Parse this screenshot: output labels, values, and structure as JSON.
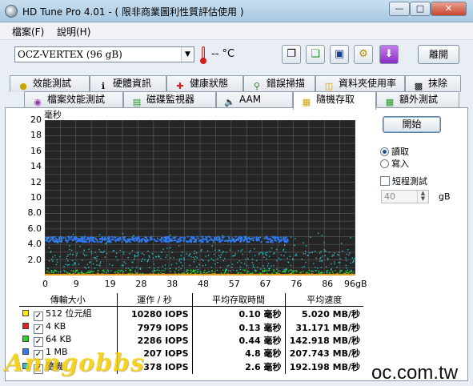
{
  "window": {
    "title": "HD Tune Pro 4.01 - ( 限非商業圖利性質評估使用 )"
  },
  "menu": [
    {
      "label": "檔案(F)"
    },
    {
      "label": "說明(H)"
    }
  ],
  "toolbar": {
    "drive": "OCZ-VERTEX (96 gB)",
    "temperature": "-- °C",
    "exit_label": "離開",
    "icons": [
      "copy-icon",
      "copy-all-icon",
      "save-icon",
      "options-icon",
      "download-icon"
    ]
  },
  "tabs_row1": [
    {
      "label": "效能測試",
      "icon": "benchmark-icon"
    },
    {
      "label": "硬體資訊",
      "icon": "info-icon"
    },
    {
      "label": "健康狀態",
      "icon": "health-icon"
    },
    {
      "label": "錯誤掃描",
      "icon": "error-scan-icon"
    },
    {
      "label": "資料夾使用率",
      "icon": "folder-usage-icon"
    },
    {
      "label": "抹除",
      "icon": "erase-icon"
    }
  ],
  "tabs_row2": [
    {
      "label": "檔案效能測試",
      "icon": "file-benchmark-icon"
    },
    {
      "label": "磁碟監視器",
      "icon": "disk-monitor-icon"
    },
    {
      "label": "AAM",
      "icon": "aam-icon"
    },
    {
      "label": "隨機存取",
      "icon": "random-access-icon",
      "active": true
    },
    {
      "label": "額外測試",
      "icon": "extra-tests-icon"
    }
  ],
  "side": {
    "start_label": "開始",
    "read_label": "讀取",
    "write_label": "寫入",
    "selected_mode": "read",
    "short_test_label": "短程測試",
    "short_test_checked": false,
    "short_test_value": "40",
    "short_test_unit": "gB"
  },
  "chart_data": {
    "type": "scatter",
    "ylabel": "毫秒",
    "y_ticks": [
      "20",
      "18",
      "16",
      "14",
      "12",
      "10",
      "8.0",
      "6.0",
      "4.0",
      "2.0"
    ],
    "x_ticks": [
      "0",
      "9",
      "19",
      "28",
      "38",
      "48",
      "57",
      "67",
      "76",
      "86",
      "96gB"
    ],
    "xlim": [
      0,
      96
    ],
    "ylim": [
      0,
      20
    ],
    "grid": true,
    "series": [
      {
        "name": "512 位元組",
        "color": "#ffea00",
        "band": [
          0.0,
          0.3
        ]
      },
      {
        "name": "4 KB",
        "color": "#e32222",
        "band": [
          0.0,
          0.3
        ]
      },
      {
        "name": "64 KB",
        "color": "#2bd42b",
        "band": [
          0.3,
          0.8
        ]
      },
      {
        "name": "1 MB",
        "color": "#2f7cf0",
        "band": [
          4.4,
          5.1
        ]
      },
      {
        "name": "隨機",
        "color": "#25c2c9",
        "band": [
          0.5,
          5.5
        ]
      }
    ]
  },
  "results": {
    "headers": [
      "傳輸大小",
      "運作 / 秒",
      "平均存取時間",
      "平均速度"
    ],
    "rows": [
      {
        "size": "512 位元組",
        "color": "#ffea00",
        "iops": "10280 IOPS",
        "access": "0.10 毫秒",
        "speed": "5.020 MB/秒"
      },
      {
        "size": "4 KB",
        "color": "#e32222",
        "iops": "7979 IOPS",
        "access": "0.13 毫秒",
        "speed": "31.171 MB/秒"
      },
      {
        "size": "64 KB",
        "color": "#2bd42b",
        "iops": "2286 IOPS",
        "access": "0.44 毫秒",
        "speed": "142.918 MB/秒"
      },
      {
        "size": "1 MB",
        "color": "#2f7cf0",
        "iops": "207 IOPS",
        "access": "4.8 毫秒",
        "speed": "207.743 MB/秒"
      },
      {
        "size": "隨機",
        "color": "#25c2c9",
        "iops": "378 IOPS",
        "access": "2.6 毫秒",
        "speed": "192.198 MB/秒"
      }
    ]
  },
  "watermarks": {
    "left": "Anngobbs",
    "right": "oc.com.tw"
  }
}
